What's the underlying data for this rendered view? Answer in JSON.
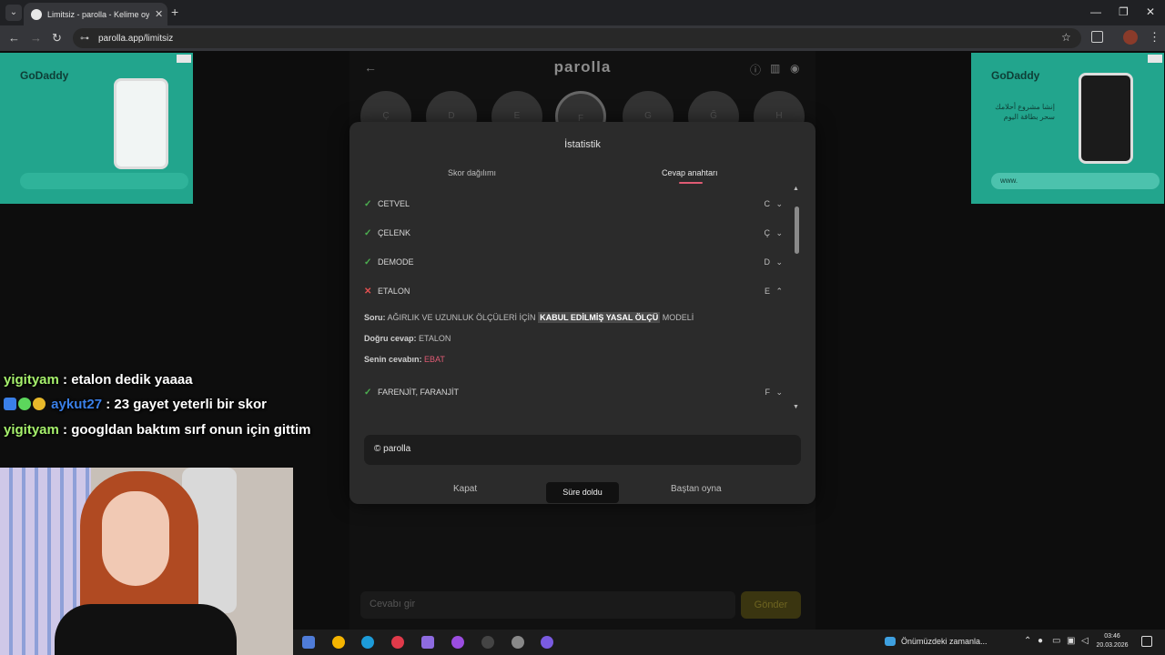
{
  "browser": {
    "tab_title": "Limitsiz - parolla - Kelime oyunu",
    "url": "parolla.app/limitsiz"
  },
  "ads": {
    "brand": "GoDaddy",
    "arabic_text": "إنشا مشروع أحلامك سحر بطاقة اليوم",
    "input_placeholder": "www."
  },
  "game": {
    "logo": "parolla",
    "circle_letters": [
      "Ç",
      "D",
      "E",
      "F",
      "G",
      "Ğ",
      "H"
    ],
    "answer_placeholder": "Cevabı gir",
    "submit_label": "Gönder"
  },
  "modal": {
    "title": "İstatistik",
    "tabs": [
      {
        "label": "Skor dağılımı",
        "active": false
      },
      {
        "label": "Cevap anahtarı",
        "active": true
      }
    ],
    "entries": [
      {
        "word": "CETVEL",
        "letter": "C",
        "status": "correct"
      },
      {
        "word": "ÇELENK",
        "letter": "Ç",
        "status": "correct"
      },
      {
        "word": "DEMODE",
        "letter": "D",
        "status": "correct"
      },
      {
        "word": "ETALON",
        "letter": "E",
        "status": "wrong",
        "expanded": true
      },
      {
        "word": "FARENJİT, FARANJİT",
        "letter": "F",
        "status": "correct"
      }
    ],
    "detail": {
      "question_label": "Soru:",
      "question_pre": "AĞIRLIK VE UZUNLUK ÖLÇÜLERİ İÇİN",
      "question_highlight": "KABUL EDİLMİŞ YASAL ÖLÇÜ",
      "question_post": "MODELİ",
      "correct_label": "Doğru cevap:",
      "correct_answer": "ETALON",
      "your_label": "Senin cevabın:",
      "your_answer": "EBAT"
    },
    "copyright": "© parolla",
    "buttons": {
      "close": "Kapat",
      "replay": "Baştan oyna"
    },
    "toast": "Süre doldu",
    "accent_color": "#e05b74"
  },
  "chat": [
    {
      "user": "yigityam",
      "message": ": etalon dedik yaaaa"
    },
    {
      "user": "aykut27",
      "message": ": 23 gayet yeterli bir skor"
    },
    {
      "user": "yigityam",
      "message": ": googldan baktım sırf onun için gittim"
    }
  ],
  "taskbar": {
    "weather": "Önümüzdeki zamanla...",
    "time": "03:46",
    "date": "20.03.2026"
  }
}
